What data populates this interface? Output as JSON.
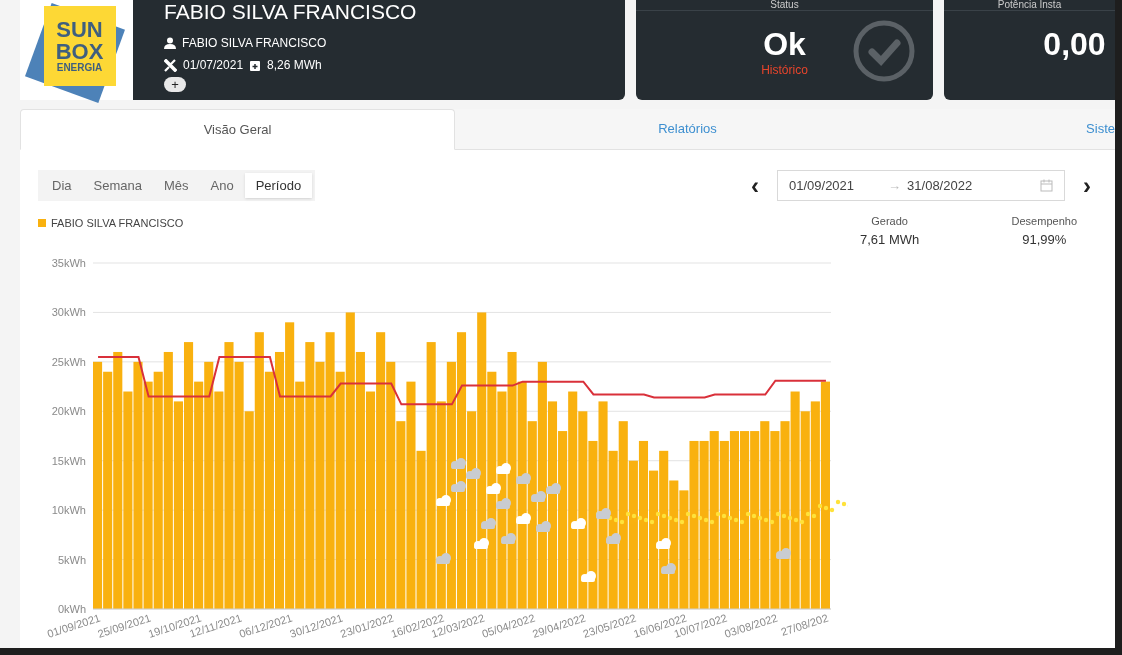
{
  "logo": {
    "lines": [
      "SUN",
      "BOX",
      "ENERGIA"
    ]
  },
  "plant": {
    "title": "FABIO SILVA FRANCISCO",
    "owner": "FABIO SILVA FRANCISCO",
    "install_date": "01/07/2021",
    "energy": "8,26 MWh",
    "more_button": "+"
  },
  "status_card": {
    "label": "Status",
    "value": "Ok",
    "link": "Histórico"
  },
  "power_card": {
    "label": "Potência Insta",
    "value": "0,00"
  },
  "tabs": [
    {
      "label": "Visão Geral",
      "selected": true
    },
    {
      "label": "Relatórios",
      "selected": false
    },
    {
      "label": "Siste",
      "selected": false
    }
  ],
  "periods": [
    {
      "label": "Dia",
      "selected": false
    },
    {
      "label": "Semana",
      "selected": false
    },
    {
      "label": "Mês",
      "selected": false
    },
    {
      "label": "Ano",
      "selected": false
    },
    {
      "label": "Período",
      "selected": true
    }
  ],
  "date_range": {
    "prev": "‹",
    "start": "01/09/2021",
    "arrow": "→",
    "end": "31/08/2022",
    "next": "›"
  },
  "stats": [
    {
      "label": "Gerado",
      "value": "7,61 MWh"
    },
    {
      "label": "Desempenho",
      "value": "91,99%"
    }
  ],
  "chart_data": {
    "type": "bar",
    "ylim": [
      0,
      35
    ],
    "grid": true,
    "categories": [
      "01/09/2021",
      null,
      null,
      null,
      null,
      "25/09/2021",
      null,
      null,
      null,
      null,
      "19/10/2021",
      null,
      null,
      null,
      "12/11/2021",
      null,
      null,
      null,
      null,
      "06/12/2021",
      null,
      null,
      null,
      null,
      "30/12/2021",
      null,
      null,
      null,
      null,
      "23/01/2022",
      null,
      null,
      null,
      null,
      "16/02/2022",
      null,
      null,
      null,
      "12/03/2022",
      null,
      null,
      null,
      null,
      "05/04/2022",
      null,
      null,
      null,
      null,
      "29/04/2022",
      null,
      null,
      null,
      null,
      "23/05/2022",
      null,
      null,
      null,
      null,
      "16/06/2022",
      null,
      null,
      null,
      "10/07/2022",
      null,
      null,
      null,
      null,
      "03/08/2022",
      null,
      null,
      null,
      null,
      "27/08/202"
    ],
    "yticks": [
      {
        "value": 0,
        "label": "0kWh"
      },
      {
        "value": 5,
        "label": "5kWh"
      },
      {
        "value": 10,
        "label": "10kWh"
      },
      {
        "value": 15,
        "label": "15kWh"
      },
      {
        "value": 20,
        "label": "20kWh"
      },
      {
        "value": 25,
        "label": "25kWh"
      },
      {
        "value": 30,
        "label": "30kWh"
      },
      {
        "value": 35,
        "label": "35kWh"
      }
    ],
    "series": [
      {
        "name": "FABIO SILVA FRANCISCO",
        "color": "#f9b10f",
        "values": [
          25,
          24,
          26,
          22,
          25,
          23,
          24,
          26,
          21,
          27,
          23,
          25,
          22,
          27,
          25,
          20,
          28,
          24,
          26,
          29,
          23,
          27,
          25,
          28,
          24,
          30,
          26,
          22,
          28,
          25,
          19,
          23,
          16,
          27,
          21,
          25,
          28,
          20,
          30,
          24,
          22,
          26,
          23,
          19,
          25,
          21,
          18,
          22,
          20,
          17,
          21,
          16,
          19,
          15,
          17,
          14,
          16,
          13,
          12,
          17,
          17,
          18,
          17,
          18,
          18,
          18,
          19,
          18,
          19,
          22,
          20,
          21,
          23
        ]
      },
      {
        "type": "line",
        "color": "#d9303a",
        "values": [
          25.5,
          25.5,
          25.5,
          25.5,
          25.5,
          21.5,
          21.5,
          21.5,
          21.5,
          21.5,
          21.5,
          21.5,
          25.5,
          25.5,
          25.5,
          25.5,
          25.5,
          25.5,
          21.5,
          21.5,
          21.5,
          21.5,
          21.5,
          21.5,
          22.8,
          22.8,
          22.8,
          22.8,
          22.8,
          22.8,
          20.7,
          20.7,
          20.7,
          20.7,
          20.7,
          20.7,
          22.6,
          22.6,
          22.6,
          22.6,
          22.6,
          22.6,
          23.0,
          23.0,
          23.0,
          23.0,
          23.0,
          23.0,
          23.0,
          21.7,
          21.7,
          21.7,
          21.7,
          21.7,
          21.7,
          21.4,
          21.4,
          21.4,
          21.4,
          21.4,
          21.4,
          21.7,
          21.7,
          21.7,
          21.7,
          21.7,
          21.7,
          23.1,
          23.1,
          23.1,
          23.1,
          23.1,
          23.1
        ]
      }
    ]
  }
}
